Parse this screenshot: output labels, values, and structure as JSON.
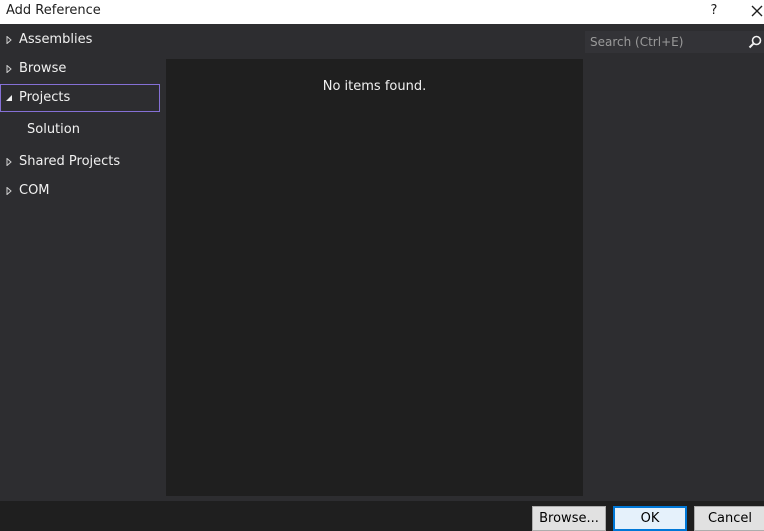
{
  "window": {
    "title": "Add Reference",
    "help_glyph": "?"
  },
  "nav": {
    "items": [
      {
        "label": "Assemblies",
        "expanded": false
      },
      {
        "label": "Browse",
        "expanded": false
      },
      {
        "label": "Projects",
        "expanded": true,
        "selected": true
      },
      {
        "label": "Solution",
        "child": true
      },
      {
        "label": "Shared Projects",
        "expanded": false
      },
      {
        "label": "COM",
        "expanded": false
      }
    ]
  },
  "search": {
    "placeholder": "Search (Ctrl+E)",
    "value": ""
  },
  "main": {
    "empty_message": "No items found."
  },
  "footer": {
    "browse_label": "Browse...",
    "ok_label": "OK",
    "cancel_label": "Cancel"
  },
  "colors": {
    "accent": "#8570d6",
    "background": "#2d2d30",
    "panel": "#1f1f1f",
    "titlebar": "#ffffff"
  },
  "icons": {
    "collapsed": "triangle-right-icon",
    "expanded": "triangle-down-icon",
    "search": "search-icon",
    "close": "close-icon"
  }
}
